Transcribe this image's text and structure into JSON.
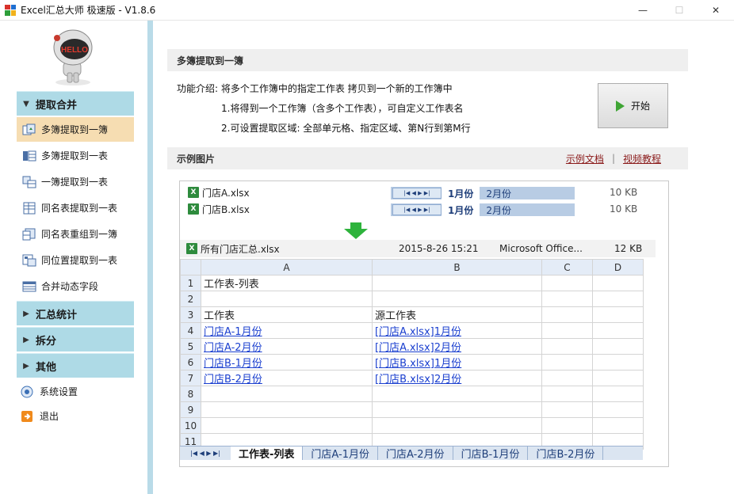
{
  "window": {
    "title": "Excel汇总大师 极速版 - V1.8.6",
    "minimize": "—",
    "maximize": "☐",
    "close": "✕"
  },
  "mascot": {
    "label": "HELLO"
  },
  "sidebar": {
    "sections": [
      {
        "label": "提取合并",
        "expanded": true
      },
      {
        "label": "汇总统计",
        "expanded": false
      },
      {
        "label": "拆分",
        "expanded": false
      },
      {
        "label": "其他",
        "expanded": false
      }
    ],
    "items": [
      {
        "label": "多簿提取到一簿",
        "active": true
      },
      {
        "label": "多簿提取到一表",
        "active": false
      },
      {
        "label": "一簿提取到一表",
        "active": false
      },
      {
        "label": "同名表提取到一表",
        "active": false
      },
      {
        "label": "同名表重组到一簿",
        "active": false
      },
      {
        "label": "同位置提取到一表",
        "active": false
      },
      {
        "label": "合并动态字段",
        "active": false
      }
    ],
    "settings_label": "系统设置",
    "exit_label": "退出"
  },
  "main": {
    "panel_title": "多簿提取到一簿",
    "intro_line": "功能介绍: 将多个工作簿中的指定工作表 拷贝到一个新的工作簿中",
    "intro_point1": "1.将得到一个工作簿（含多个工作表），可自定义工作表名",
    "intro_point2": "2.可设置提取区域: 全部单元格、指定区域、第N行到第M行",
    "start_label": "开始",
    "example_title": "示例图片",
    "link_doc": "示例文档",
    "link_sep": "|",
    "link_video": "视频教程"
  },
  "example": {
    "source_files": [
      {
        "name": "门店A.xlsx",
        "size": "10 KB",
        "tabs": [
          "1月份",
          "2月份"
        ]
      },
      {
        "name": "门店B.xlsx",
        "size": "10 KB",
        "tabs": [
          "1月份",
          "2月份"
        ]
      }
    ],
    "mini_nav": "|◀ ◀ ▶ ▶|",
    "output_file": {
      "name": "所有门店汇总.xlsx",
      "date": "2015-8-26 15:21",
      "type": "Microsoft Office...",
      "size": "12 KB"
    },
    "columns": [
      "A",
      "B",
      "C",
      "D"
    ],
    "rows": [
      {
        "n": "1",
        "a": "工作表-列表",
        "b": "",
        "link": false
      },
      {
        "n": "2",
        "a": "",
        "b": "",
        "link": false
      },
      {
        "n": "3",
        "a": "工作表",
        "b": "源工作表",
        "link": false
      },
      {
        "n": "4",
        "a": "门店A-1月份",
        "b": "[门店A.xlsx]1月份",
        "link": true
      },
      {
        "n": "5",
        "a": "门店A-2月份",
        "b": "[门店A.xlsx]2月份",
        "link": true
      },
      {
        "n": "6",
        "a": "门店B-1月份",
        "b": "[门店B.xlsx]1月份",
        "link": true
      },
      {
        "n": "7",
        "a": "门店B-2月份",
        "b": "[门店B.xlsx]2月份",
        "link": true
      },
      {
        "n": "8",
        "a": "",
        "b": "",
        "link": false
      },
      {
        "n": "9",
        "a": "",
        "b": "",
        "link": false
      },
      {
        "n": "10",
        "a": "",
        "b": "",
        "link": false
      },
      {
        "n": "11",
        "a": "",
        "b": "",
        "link": false
      }
    ],
    "sheet_tabs": [
      "工作表-列表",
      "门店A-1月份",
      "门店A-2月份",
      "门店B-1月份",
      "门店B-2月份"
    ],
    "sheet_nav": "|◀ ◀ ▶ ▶|"
  }
}
